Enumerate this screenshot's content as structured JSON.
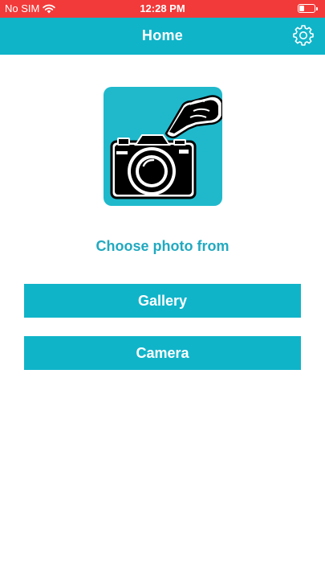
{
  "status_bar": {
    "carrier": "No SIM",
    "time": "12:28 PM",
    "wifi_icon": "wifi-icon",
    "battery_icon": "battery-icon"
  },
  "nav": {
    "title": "Home",
    "settings_icon": "gear-icon"
  },
  "hero": {
    "icon": "camera-with-pointing-hand-icon"
  },
  "prompt": "Choose photo from",
  "buttons": {
    "gallery": "Gallery",
    "camera": "Camera"
  },
  "colors": {
    "status_bar": "#f23a3a",
    "accent": "#10b4c9",
    "prompt_text": "#22a9c0",
    "button_text": "#ffffff"
  }
}
